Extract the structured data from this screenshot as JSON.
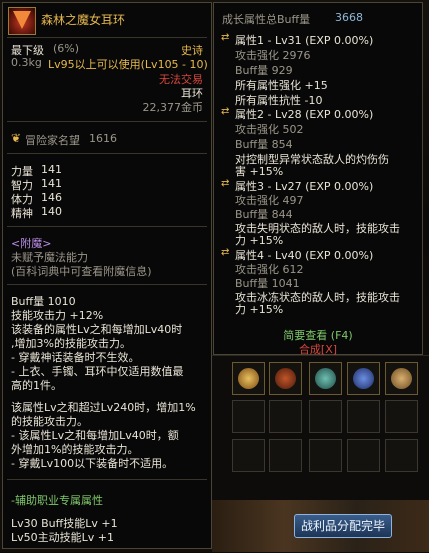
{
  "item": {
    "name": "森林之魔女耳环",
    "grade_label": "最下级",
    "grade_percent": "(6%)",
    "rarity": "史诗",
    "weight": "0.3kg",
    "level_req": "Lv95以上可以使用(Lv105 - 10)",
    "trade": "无法交易",
    "slot_type": "耳环",
    "price": "22,377金币",
    "adventurer_fame_label": "冒险家名望",
    "adventurer_fame_value": "1616",
    "stats": [
      {
        "label": "力量",
        "value": "141"
      },
      {
        "label": "智力",
        "value": "141"
      },
      {
        "label": "体力",
        "value": "146"
      },
      {
        "label": "精神",
        "value": "140"
      }
    ],
    "enchant_header": "<附魔>",
    "enchant_lines": [
      "未赋予魔法能力",
      "(百科词典中可查看附魔信息)"
    ],
    "buff_lines": [
      "Buff量 1010",
      "技能攻击力 +12%",
      "该装备的属性Lv之和每增加Lv40时",
      ",增加3%的技能攻击力。",
      "- 穿戴神话装备时不生效。",
      "- 上衣、手镯、耳环中仅适用数值最",
      "高的1件。"
    ],
    "extra_lines": [
      "该属性Lv之和超过Lv240时，增加1%",
      "的技能攻击力。",
      "- 该属性Lv之和每增加Lv40时，额",
      "外增加1%的技能攻击力。",
      "- 穿戴Lv100以下装备时不适用。"
    ],
    "support_header": "-辅助职业专属属性",
    "support_lines": [
      "Lv30 Buff技能Lv +1",
      "Lv50主动技能Lv +1"
    ]
  },
  "growth": {
    "title": "成长属性总Buff量",
    "total": "3668",
    "attrs": [
      {
        "head": "属性1 - Lv31 (EXP 0.00%)",
        "lines": [
          "攻击强化 2976",
          "Buff量 929",
          "所有属性强化 +15",
          "所有属性抗性 -10"
        ]
      },
      {
        "head": "属性2 - Lv28 (EXP 0.00%)",
        "lines": [
          "攻击强化 502",
          "Buff量 854",
          "对控制型异常状态敌人的灼伤伤",
          "害 +15%"
        ]
      },
      {
        "head": "属性3 - Lv27 (EXP 0.00%)",
        "lines": [
          "攻击强化 497",
          "Buff量 844",
          "攻击失明状态的敌人时，技能攻击",
          "力 +15%"
        ]
      },
      {
        "head": "属性4 - Lv40 (EXP 0.00%)",
        "lines": [
          "攻击强化 612",
          "Buff量 1041",
          "攻击冰冻状态的敌人时，技能攻击",
          "力 +15%"
        ]
      }
    ],
    "brief_view": "简要查看 (F4)",
    "synthesis": "合成[X]"
  },
  "loot_button": "战利品分配完毕",
  "colors": {
    "gold": "#e6b84e",
    "rarity_epic": "#e6b84e",
    "untradeable": "#d6473d",
    "buff_link": "#7fc86a"
  }
}
